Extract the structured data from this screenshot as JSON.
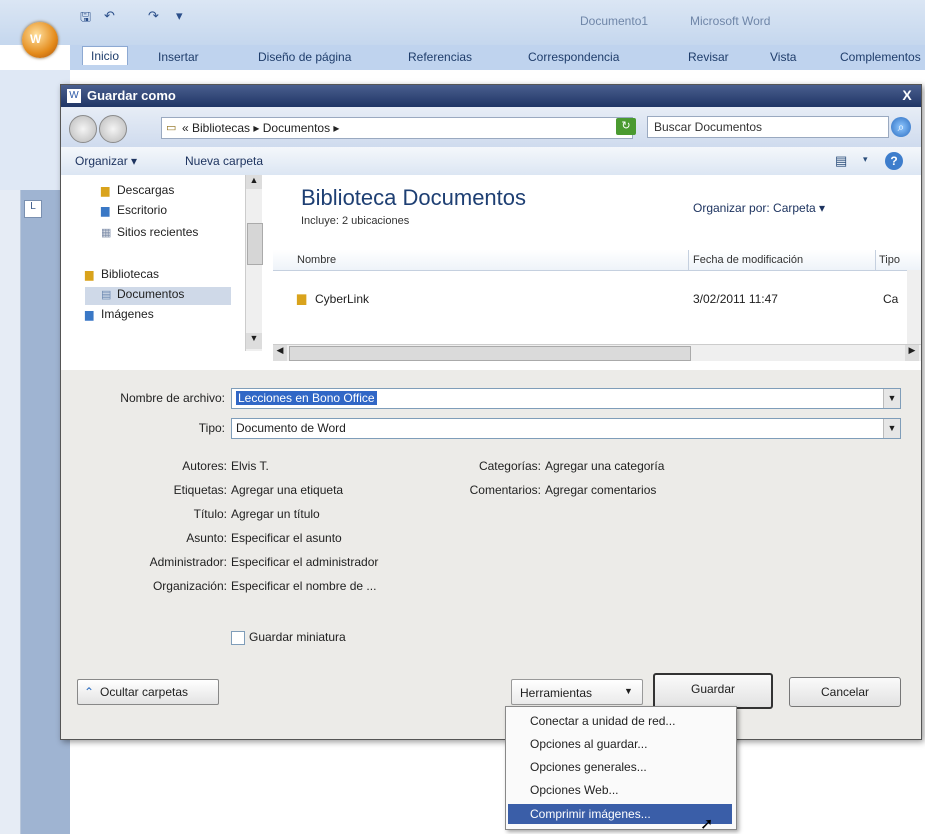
{
  "word": {
    "office_button_letter": "W",
    "doc_title": "Documento1",
    "app_title": "Microsoft Word",
    "ribbon_tabs": [
      "Inicio",
      "Insertar",
      "Diseño de página",
      "Referencias",
      "Correspondencia",
      "Revisar",
      "Vista",
      "Complementos"
    ]
  },
  "dialog": {
    "title": "Guardar como",
    "close": "X",
    "address": "« Bibliotecas ▸ Documentos ▸",
    "search_placeholder": "Buscar Documentos",
    "toolbar": {
      "organize": "Organizar ▾",
      "new_folder": "Nueva carpeta"
    },
    "nav_items": [
      {
        "label": "Descargas",
        "icon": "downloads-icon"
      },
      {
        "label": "Escritorio",
        "icon": "desktop-icon"
      },
      {
        "label": "Sitios recientes",
        "icon": "recent-places-icon"
      },
      {
        "label": "Bibliotecas",
        "icon": "libraries-icon"
      },
      {
        "label": "Documentos",
        "icon": "documents-icon",
        "selected": true
      },
      {
        "label": "Imágenes",
        "icon": "pictures-icon"
      }
    ],
    "library": {
      "title": "Biblioteca Documentos",
      "subtitle": "Incluye: 2 ubicaciones",
      "arrange_by": "Organizar por:  Carpeta ▾",
      "columns": [
        "Nombre",
        "Fecha de modificación",
        "Tipo"
      ],
      "files": [
        {
          "name": "CyberLink",
          "date": "3/02/2011 11:47",
          "type": "Ca"
        }
      ]
    },
    "form": {
      "filename_label": "Nombre de archivo:",
      "filename_value": "Lecciones en Bono Office",
      "type_label": "Tipo:",
      "type_value": "Documento de Word",
      "meta_left": [
        {
          "label": "Autores:",
          "value": "Elvis T."
        },
        {
          "label": "Etiquetas:",
          "value": "Agregar una etiqueta"
        },
        {
          "label": "Título:",
          "value": "Agregar un título"
        },
        {
          "label": "Asunto:",
          "value": "Especificar el asunto"
        },
        {
          "label": "Administrador:",
          "value": "Especificar el administrador"
        },
        {
          "label": "Organización:",
          "value": "Especificar el nombre de ..."
        }
      ],
      "meta_right": [
        {
          "label": "Categorías:",
          "value": "Agregar una categoría"
        },
        {
          "label": "Comentarios:",
          "value": "Agregar comentarios"
        }
      ],
      "thumbnail_label": "Guardar miniatura"
    },
    "buttons": {
      "hide_folders": "Ocultar carpetas",
      "tools": "Herramientas",
      "save": "Guardar",
      "cancel": "Cancelar"
    },
    "tools_menu": [
      "Conectar a unidad de red...",
      "Opciones al guardar...",
      "Opciones generales...",
      "Opciones Web...",
      "Comprimir imágenes..."
    ]
  }
}
